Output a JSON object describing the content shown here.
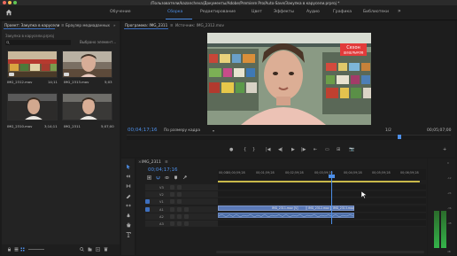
{
  "window": {
    "title": "/Пользователи/kazancheva/Документы/Adobe/Premiere Pro/Auto-Save/Закупка в карусели.prproj *"
  },
  "workspaces": [
    {
      "label": "Обучение",
      "active": false
    },
    {
      "label": "Сборка",
      "active": true
    },
    {
      "label": "Редактирование",
      "active": false
    },
    {
      "label": "Цвет",
      "active": false
    },
    {
      "label": "Эффекты",
      "active": false
    },
    {
      "label": "Аудио",
      "active": false
    },
    {
      "label": "Графика",
      "active": false
    },
    {
      "label": "Библиотеки",
      "active": false
    }
  ],
  "workspaces_more": "»",
  "project": {
    "tab_label": "Проект: Закупка в карусели",
    "menu_glyph": "≡",
    "media_browser_tab": "Браузер медиаданных",
    "more_glyph": "»",
    "path": "Закупка в карусели.prproj",
    "selection_text": "Выбрано элемент...",
    "items": [
      {
        "name": "IMG_2312.mov",
        "duration": "14;11"
      },
      {
        "name": "IMG_2313.mov",
        "duration": "5;03"
      },
      {
        "name": "IMG_2310.mov",
        "duration": "3;14;11"
      },
      {
        "name": "IMG_2311",
        "duration": "5;07;00"
      }
    ]
  },
  "program": {
    "tab_label": "Программа: IMG_2311",
    "menu_glyph": "≡",
    "source_tab": "Источник: IMG_2312.mov",
    "timecode": "00;04;17;16",
    "fit_label": "По размеру кадра",
    "fit_arrow": "▾",
    "resolution": "1/2",
    "duration": "00;05;07;00",
    "controls": [
      "●",
      "{",
      "}",
      "|◀",
      "◀|",
      "▶",
      "|▶",
      "⇤",
      "▭",
      "⊞",
      "📷",
      "+"
    ]
  },
  "video_frame": {
    "store_sign": "Сезон шашлыков",
    "store_sign_color": "#e23a3a"
  },
  "timeline": {
    "sequence_tab": "IMG_2311",
    "close_glyph": "×",
    "menu_glyph": "≡",
    "timecode": "00;04;17;16",
    "ruler_labels": [
      "00;00",
      "00;00;59;28",
      "00;01;59;28",
      "00;02;59;28",
      "00;03;59;28",
      "00;04;59;28",
      "00;05;59;28",
      "00;06;59;28",
      "00;07;59;28"
    ],
    "tracks": [
      {
        "name": "V3",
        "kind": "video"
      },
      {
        "name": "V2",
        "kind": "video"
      },
      {
        "name": "V1",
        "kind": "video"
      },
      {
        "name": "A1",
        "kind": "audio"
      },
      {
        "name": "A2",
        "kind": "audio"
      },
      {
        "name": "A3",
        "kind": "audio"
      }
    ],
    "clips": [
      {
        "label": "IMG_2311.mov [V]",
        "track": "V1"
      },
      {
        "label": "IMG_2312.mov [V]",
        "track": "V1"
      },
      {
        "label": "IMG_2313.mov",
        "track": "V1"
      }
    ],
    "playhead_time": "00;04;17;16"
  },
  "meters": {
    "ticks": [
      "0",
      "-12",
      "-24",
      "-36",
      "-48",
      "dB"
    ]
  },
  "colors": {
    "accent": "#4d8fe8",
    "clip_video": "#5b79b7",
    "clip_audio": "#4d6fa8",
    "work_area": "#c9b94a"
  }
}
